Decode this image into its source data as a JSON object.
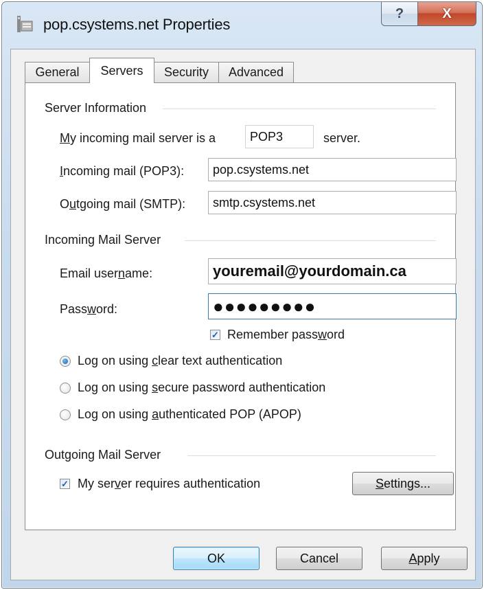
{
  "window": {
    "title": "pop.csystems.net Properties",
    "icon": "properties-window-icon",
    "help_glyph": "?",
    "close_glyph": "X"
  },
  "tabs": [
    {
      "label": "General",
      "active": false
    },
    {
      "label": "Servers",
      "active": true
    },
    {
      "label": "Security",
      "active": false
    },
    {
      "label": "Advanced",
      "active": false
    }
  ],
  "server_info": {
    "heading": "Server Information",
    "server_type_prefix_u": "M",
    "server_type_prefix_rest": "y incoming mail server is a",
    "server_type_value": "POP3",
    "server_type_suffix": "server.",
    "incoming_label_u": "I",
    "incoming_label_rest": "ncoming mail (POP3):",
    "incoming_value": "pop.csystems.net",
    "outgoing_label_pre": "O",
    "outgoing_label_u": "u",
    "outgoing_label_rest": "tgoing mail (SMTP):",
    "outgoing_value": "smtp.csystems.net"
  },
  "incoming_server": {
    "heading": "Incoming Mail Server",
    "username_label_pre": "Email user",
    "username_label_u": "n",
    "username_label_rest": "ame:",
    "username_value": "youremail@yourdomain.ca",
    "password_label_pre": "Pass",
    "password_label_u": "w",
    "password_label_rest": "ord:",
    "password_value": "●●●●●●●●●",
    "remember_pre": "Remember pass",
    "remember_u": "w",
    "remember_rest": "ord",
    "remember_checked": true,
    "auth_options": [
      {
        "pre": "Log on using ",
        "u": "c",
        "rest": "lear text authentication",
        "selected": true
      },
      {
        "pre": "Log on using ",
        "u": "s",
        "rest": "ecure password authentication",
        "selected": false
      },
      {
        "pre": "Log on using ",
        "u": "a",
        "rest": "uthenticated POP (APOP)",
        "selected": false
      }
    ]
  },
  "outgoing_server": {
    "heading": "Outgoing Mail Server",
    "requires_auth_pre": "My ser",
    "requires_auth_u": "v",
    "requires_auth_rest": "er requires authentication",
    "requires_auth_checked": true,
    "settings_pre": "S",
    "settings_u": "e",
    "settings_rest": "ttings..."
  },
  "buttons": {
    "ok": "OK",
    "cancel": "Cancel",
    "apply_u": "A",
    "apply_rest": "pply"
  },
  "check_glyph": "✓"
}
